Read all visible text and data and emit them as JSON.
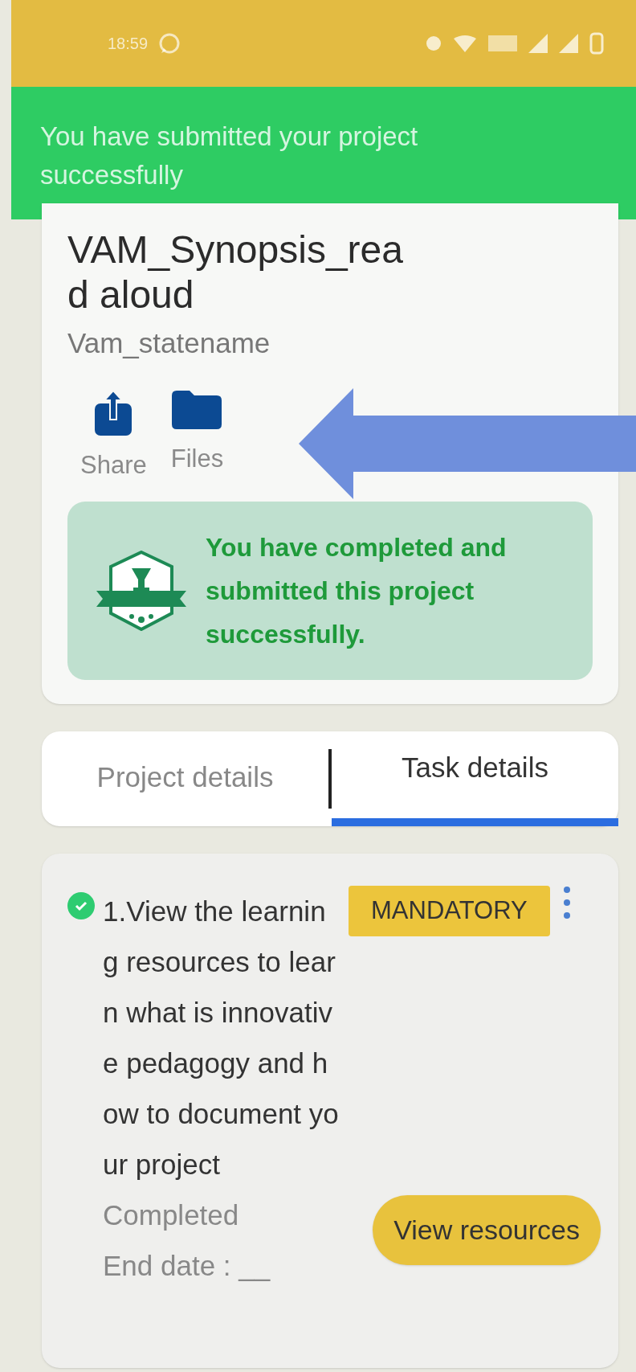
{
  "status_bar": {
    "time": "18:59"
  },
  "toast": {
    "message": "You have submitted your project successfully"
  },
  "project": {
    "title": "VAM_Synopsis_read aloud",
    "subtitle": "Vam_statename",
    "actions": [
      {
        "kind": "share",
        "label": "Share"
      },
      {
        "kind": "files",
        "label": "Files"
      }
    ],
    "completion_banner": "You have completed and submitted this project successfully."
  },
  "tabs": [
    {
      "label": "Project details",
      "selected": false
    },
    {
      "label": "Task details",
      "selected": true
    }
  ],
  "tasks": [
    {
      "title": "1.View the learning resources to learn what is innovative pedagogy and how to document your project",
      "done": true,
      "badge": "MANDATORY",
      "status": "Completed",
      "end_date": "End date : __",
      "button": "View resources"
    }
  ]
}
